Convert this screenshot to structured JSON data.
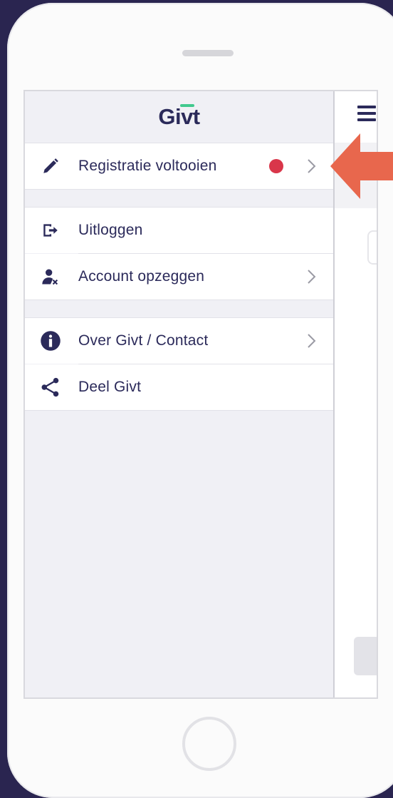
{
  "app": {
    "logo_text": "Givt",
    "brand_color": "#2b2a5a",
    "accent_color": "#41c98e"
  },
  "menu": {
    "items": [
      {
        "label": "Registratie voltooien",
        "icon": "pencil-icon",
        "has_chevron": true,
        "badge": "red-dot"
      },
      {
        "label": "Uitloggen",
        "icon": "logout-icon",
        "has_chevron": false
      },
      {
        "label": "Account opzeggen",
        "icon": "user-remove-icon",
        "has_chevron": true
      },
      {
        "label": "Over Givt / Contact",
        "icon": "info-icon",
        "has_chevron": true
      },
      {
        "label": "Deel Givt",
        "icon": "share-icon",
        "has_chevron": false
      }
    ]
  },
  "colors": {
    "badge": "#d9364a",
    "arrow": "#e8674d",
    "frame": "#2a2550"
  }
}
